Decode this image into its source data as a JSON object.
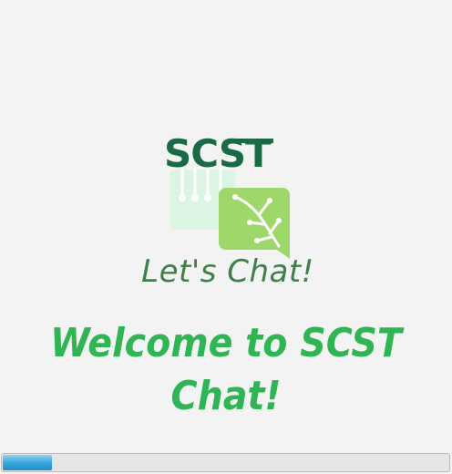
{
  "logo": {
    "wordmark": "SCST",
    "tagline": "Let's Chat!",
    "colors": {
      "wordmark": "#1a6b45",
      "circuit": "#c6efd2",
      "bubble": "#9ed86a",
      "tagline": "#3f7f48"
    }
  },
  "welcome": {
    "text": "Welcome to SCST Chat!",
    "color": "#2fb553"
  },
  "progress": {
    "value": 0.11,
    "color": "#3aa8dc"
  }
}
